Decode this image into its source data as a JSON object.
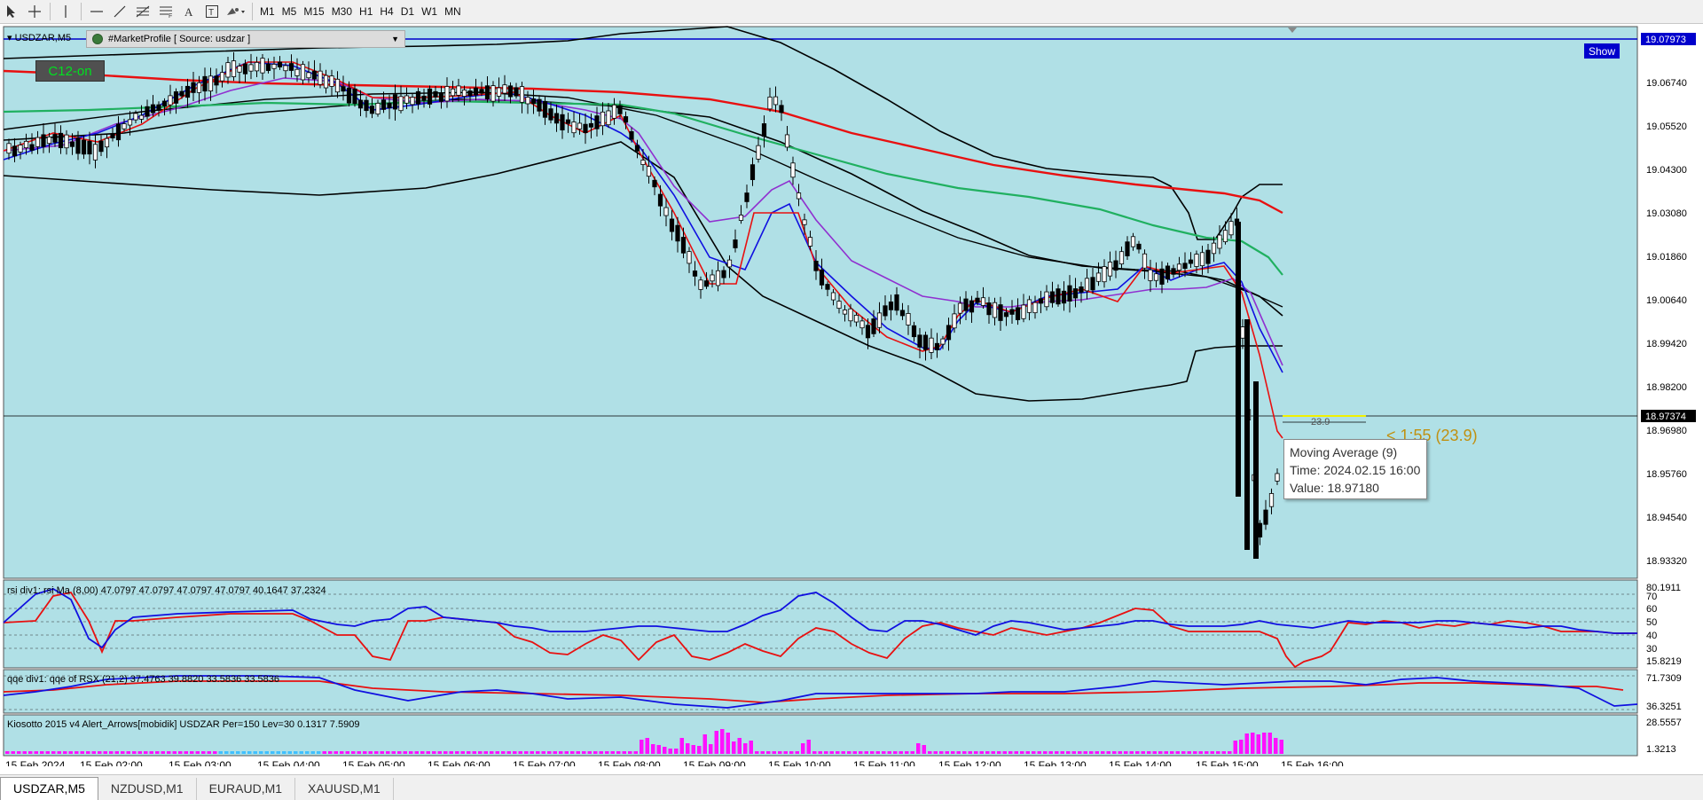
{
  "toolbar": {
    "tools": [
      "cursor-icon",
      "crosshair-icon",
      "vertical-line-icon",
      "horizontal-line-icon",
      "trendline-icon",
      "fibonacci-icon",
      "channel-icon",
      "text-icon",
      "text-label-icon",
      "shapes-icon"
    ],
    "timeframes": [
      "M1",
      "M5",
      "M15",
      "M30",
      "H1",
      "H4",
      "D1",
      "W1",
      "MN"
    ]
  },
  "chart": {
    "symbol_label": "USDZAR,M5",
    "market_profile_label": "#MarketProfile [ Source: usdzar ]",
    "c12_label": "C12-on",
    "show_label": "Show",
    "price_axis": [
      "19.06740",
      "19.05520",
      "19.04300",
      "19.03080",
      "19.01860",
      "19.00640",
      "18.99420",
      "18.98200",
      "18.96980",
      "18.95760",
      "18.94540",
      "18.93320"
    ],
    "current_price": "19.07973",
    "crosshair_price": "18.97374",
    "countdown_label": "< 1:55 (23.9)",
    "level_label": "23.9",
    "tooltip": {
      "title": "Moving Average (9)",
      "time": "Time: 2024.02.15 16:00",
      "value": "Value: 18.97180"
    },
    "time_axis": [
      "15 Feb 2024",
      "15 Feb 02:00",
      "15 Feb 03:00",
      "15 Feb 04:00",
      "15 Feb 05:00",
      "15 Feb 06:00",
      "15 Feb 07:00",
      "15 Feb 08:00",
      "15 Feb 09:00",
      "15 Feb 10:00",
      "15 Feb 11:00",
      "15 Feb 12:00",
      "15 Feb 13:00",
      "15 Feb 14:00",
      "15 Feb 15:00",
      "15 Feb 16:00"
    ]
  },
  "rsi_panel": {
    "label": "rsi div1: rsi Ma (8,00) 47.0797 47.0797 47.0797 47.0797 40.1647 37.2324",
    "axis": [
      "80.1911",
      "70",
      "60",
      "50",
      "40",
      "30",
      "15.8219"
    ]
  },
  "qqe_panel": {
    "label": "qqe div1: qqe of RSX (21,2) 37.4763 39.8820 33.5836 33.5836",
    "axis": [
      "71.7309",
      "36.3251"
    ]
  },
  "kio_panel": {
    "label": "Kiosotto 2015 v4 Alert_Arrows[mobidik] USDZAR Per=150 Lev=30 0.1317 7.5909",
    "axis": [
      "28.5557",
      "1.3213"
    ]
  },
  "tabs": [
    "USDZAR,M5",
    "NZDUSD,M1",
    "EURAUD,M1",
    "XAUUSD,M1"
  ],
  "colors": {
    "chart_bg": "#b0e0e6",
    "ma_red": "#e81010",
    "ma_green": "#20b060",
    "ma_purple": "#9030d0",
    "ma_blue": "#1010e0",
    "histogram": "#ff10ff",
    "price_tag": "#0000cc"
  }
}
